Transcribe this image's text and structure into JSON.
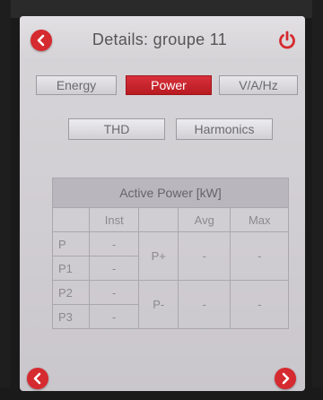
{
  "header": {
    "title": "Details: groupe 11"
  },
  "tabs": [
    {
      "label": "Energy",
      "active": false
    },
    {
      "label": "Power",
      "active": true
    },
    {
      "label": "V/A/Hz",
      "active": false
    }
  ],
  "subtabs": [
    {
      "label": "THD"
    },
    {
      "label": "Harmonics"
    }
  ],
  "table": {
    "caption": "Active Power [kW]",
    "columns": [
      "",
      "Inst",
      "",
      "Avg",
      "Max"
    ],
    "rows": [
      {
        "label": "P",
        "inst": "-"
      },
      {
        "label": "P1",
        "inst": "-"
      },
      {
        "label": "P2",
        "inst": "-"
      },
      {
        "label": "P3",
        "inst": "-"
      }
    ],
    "groups": [
      {
        "label": "P+",
        "avg": "-",
        "max": "-"
      },
      {
        "label": "P-",
        "avg": "-",
        "max": "-"
      }
    ]
  },
  "colors": {
    "accent": "#d52a2f",
    "background": "#d3d1d5"
  },
  "icons": {
    "back": "chevron-left-icon",
    "power": "power-icon",
    "prev": "chevron-left-icon",
    "next": "chevron-right-icon"
  }
}
